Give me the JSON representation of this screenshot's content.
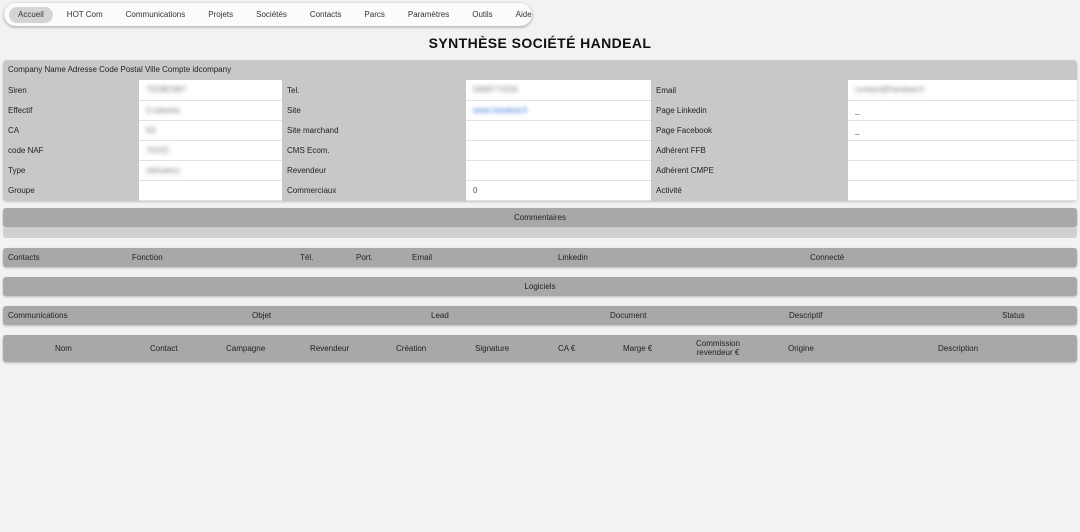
{
  "nav": {
    "items": [
      "Accueil",
      "HOT Com",
      "Communications",
      "Projets",
      "Sociétés",
      "Contacts",
      "Parcs",
      "Paramètres",
      "Outils",
      "Aide"
    ],
    "active": "Accueil"
  },
  "title": "SYNTHÈSE SOCIÉTÉ HANDEAL",
  "company": {
    "header": "Company Name Adresse Code Postal Ville Compte idcompany",
    "rows": [
      {
        "l1": "Siren",
        "v1": "791881987",
        "l2": "Tel.",
        "v2": "0468771556",
        "l3": "Email",
        "v3": "contact@handeal.fr"
      },
      {
        "l1": "Effectif",
        "v1": "3 salariés",
        "l2": "Site",
        "v2": "www.handeal.fr",
        "l3": "Page Linkedin",
        "v3": "_"
      },
      {
        "l1": "CA",
        "v1": "K€",
        "l2": "Site marchand",
        "v2": "",
        "l3": "Page Facebook",
        "v3": "_"
      },
      {
        "l1": "code NAF",
        "v1": "7022Z",
        "l2": "CMS Ecom.",
        "v2": "",
        "l3": "Adhérent FFB",
        "v3": ""
      },
      {
        "l1": "Type",
        "v1": "utilisateur",
        "l2": "Revendeur",
        "v2": "",
        "l3": "Adhérent CMPE",
        "v3": ""
      },
      {
        "l1": "Groupe",
        "v1": "",
        "l2": "Commerciaux",
        "v2": "0",
        "l3": "Activité",
        "v3": ""
      }
    ]
  },
  "sections": {
    "commentaires": "Commentaires",
    "logiciels": "Logiciels"
  },
  "contacts_header": [
    "Contacts",
    "Fonction",
    "Tél.",
    "Port.",
    "Email",
    "Linkedin",
    "Connecté"
  ],
  "communications_header": [
    "Communications",
    "Objet",
    "Lead",
    "Document",
    "Descriptif",
    "Status"
  ],
  "projects_header": [
    "Nom",
    "Contact",
    "Campagne",
    "Revendeur",
    "Création",
    "Signature",
    "CA €",
    "Marge €",
    "Commission",
    "revendeur €",
    "Origine",
    "Description"
  ]
}
